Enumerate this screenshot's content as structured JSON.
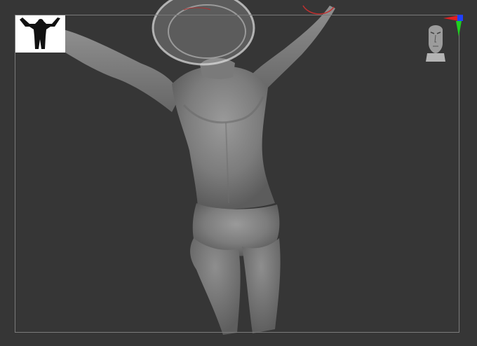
{
  "app": {
    "name": "sculpt-viewport"
  },
  "viewport": {
    "background": "#363636",
    "frame_color": "#7a7a7a",
    "model_color": "#8a8a8a",
    "brush_color": "#d0d0d0"
  },
  "icons": {
    "navigator": "figure-silhouette-icon",
    "head_gizmo": "head-orientation-icon",
    "axis_gizmo": "xyz-axis-icon"
  },
  "axis_colors": {
    "x": "#e02020",
    "y": "#20d020",
    "z": "#2040ff"
  }
}
